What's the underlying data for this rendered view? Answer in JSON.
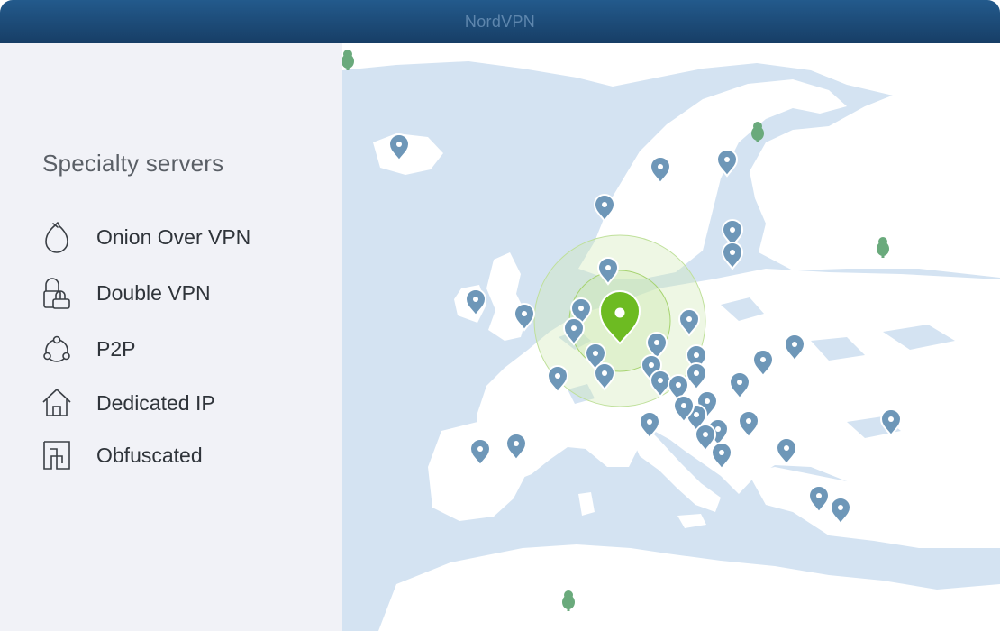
{
  "window": {
    "title": "NordVPN"
  },
  "sidebar": {
    "heading": "Specialty servers",
    "items": [
      {
        "label": "Onion Over VPN",
        "icon": "onion-icon"
      },
      {
        "label": "Double VPN",
        "icon": "double-lock-icon"
      },
      {
        "label": "P2P",
        "icon": "p2p-icon"
      },
      {
        "label": "Dedicated IP",
        "icon": "home-icon"
      },
      {
        "label": "Obfuscated",
        "icon": "obfuscated-icon"
      }
    ]
  },
  "map": {
    "land_color": "#ffffff",
    "water_color": "#d4e3f2",
    "pin_color": "#6e97b8",
    "active_pin_color": "#6dbb22",
    "tree_color": "#6aaa7c",
    "server_pin_count": 40,
    "connected_location": "active-pin"
  }
}
